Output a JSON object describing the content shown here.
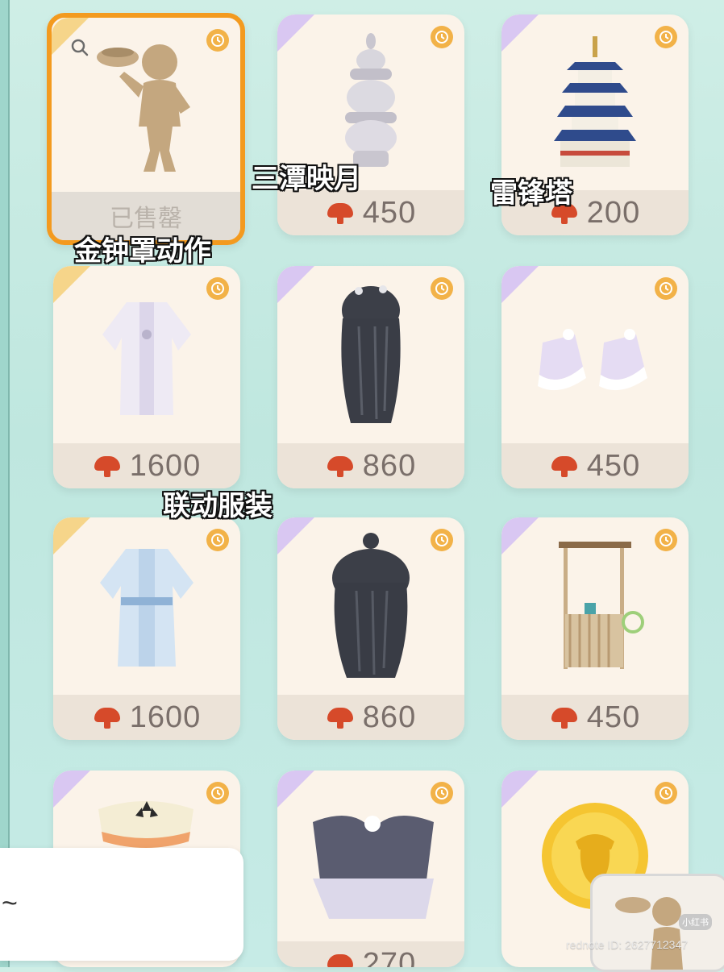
{
  "items": [
    {
      "name": "金钟罩动作",
      "status": "已售罄",
      "price": null,
      "annotation": "金钟罩动作",
      "selected": true
    },
    {
      "name": "三潭映月",
      "price": "450",
      "annotation": "三潭映月"
    },
    {
      "name": "雷锋塔",
      "price": "200",
      "annotation": "雷锋塔"
    },
    {
      "name": "outfit-white",
      "price": "1600",
      "annotation": "联动服装"
    },
    {
      "name": "hair-long-black",
      "price": "860"
    },
    {
      "name": "shoes-lilac",
      "price": "450"
    },
    {
      "name": "outfit-blue",
      "price": "1600"
    },
    {
      "name": "hair-bun-black",
      "price": "860"
    },
    {
      "name": "vendor-cart",
      "price": "450"
    },
    {
      "name": "hat-cream",
      "price": ""
    },
    {
      "name": "hair-bow",
      "price": "270"
    },
    {
      "name": "acorn-coin",
      "price": ""
    }
  ],
  "annotations": {
    "a1": "三潭映月",
    "a2": "雷锋塔",
    "a3": "金钟罩动作",
    "a4": "联动服装"
  },
  "sold_out": "已售罄",
  "overlay": {
    "tilde": "~"
  },
  "watermark": "rednote ID: 2627712347",
  "mini_tag": "小红书",
  "colors": {
    "accent_orange": "#f39a1f",
    "currency_red": "#d64a2a",
    "clock_gold": "#f2b248",
    "card_bg": "#fbf3e9"
  }
}
